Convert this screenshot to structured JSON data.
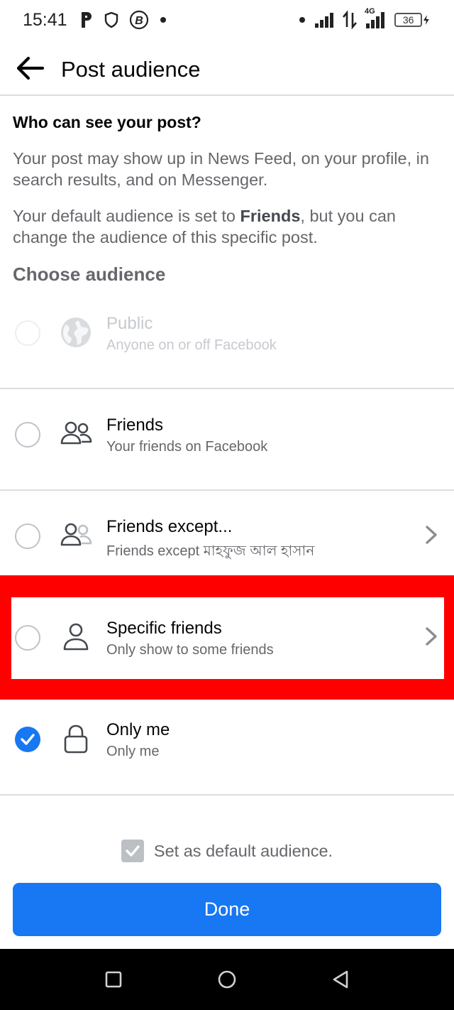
{
  "status_bar": {
    "time": "15:41",
    "left_icons": [
      "p-app-icon",
      "shield-icon",
      "bitcoin-icon",
      "dot-icon"
    ],
    "right_icons": [
      "dot-icon",
      "signal-icon",
      "data-transfer-icon",
      "4g-signal-icon",
      "battery-icon"
    ],
    "network": "4G",
    "battery": "36"
  },
  "app_bar": {
    "title": "Post audience"
  },
  "content": {
    "question": "Who can see your post?",
    "description_1": "Your post may show up in News Feed, on your profile, in search results, and on Messenger.",
    "description_2_prefix": "Your default audience is set to ",
    "description_2_bold": "Friends",
    "description_2_suffix": ", but you can change the audience of this specific post.",
    "choose_title": "Choose audience"
  },
  "options": [
    {
      "title": "Public",
      "subtitle": "Anyone on or off Facebook",
      "icon": "globe-icon",
      "selected": false,
      "disabled": true,
      "chevron": false
    },
    {
      "title": "Friends",
      "subtitle": "Your friends on Facebook",
      "icon": "friends-icon",
      "selected": false,
      "disabled": false,
      "chevron": false
    },
    {
      "title": "Friends except...",
      "subtitle": "Friends except মাহফুজ আল হাসান",
      "icon": "friends-except-icon",
      "selected": false,
      "disabled": false,
      "chevron": true
    },
    {
      "title": "Specific friends",
      "subtitle": "Only show to some friends",
      "icon": "person-icon",
      "selected": false,
      "disabled": false,
      "chevron": true
    },
    {
      "title": "Only me",
      "subtitle": "Only me",
      "icon": "lock-icon",
      "selected": true,
      "disabled": false,
      "chevron": false
    }
  ],
  "default_audience": {
    "label": "Set as default audience.",
    "checked": true
  },
  "done_button": {
    "label": "Done"
  },
  "colors": {
    "accent": "#1877f2",
    "highlight": "#ff0000",
    "secondary_text": "#65676b",
    "divider": "#dadde1"
  }
}
